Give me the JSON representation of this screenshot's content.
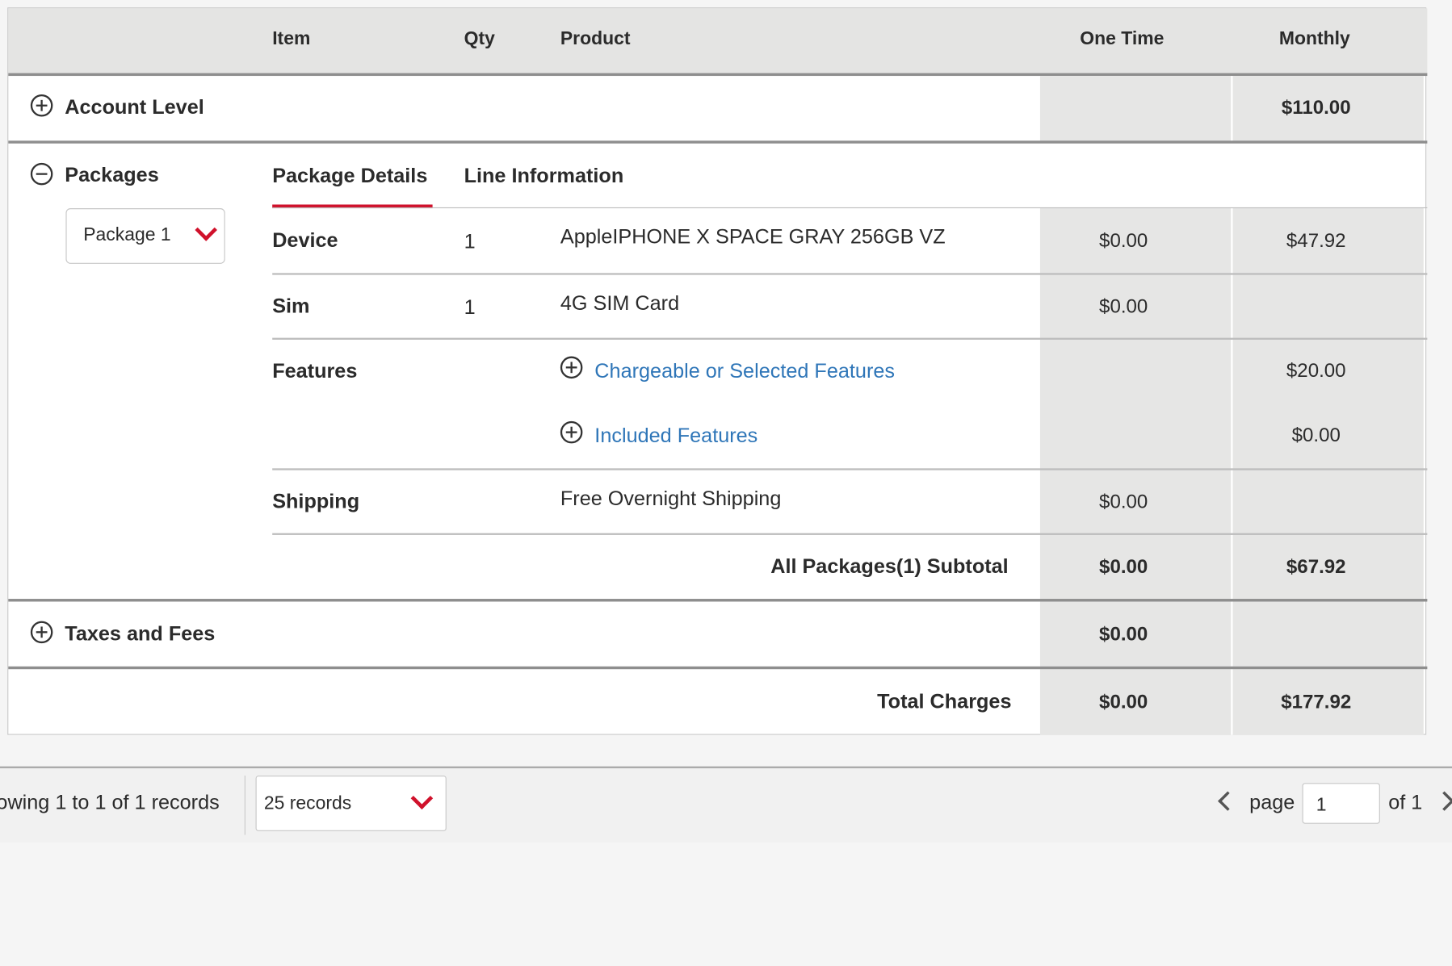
{
  "header": {
    "item": "Item",
    "qty": "Qty",
    "product": "Product",
    "one_time": "One Time",
    "monthly": "Monthly"
  },
  "account_level": {
    "label": "Account Level",
    "one_time": "",
    "monthly": "$110.00"
  },
  "packages": {
    "label": "Packages",
    "selected_package": "Package 1",
    "tabs": [
      "Package Details",
      "Line Information"
    ],
    "rows": {
      "device": {
        "label": "Device",
        "qty": "1",
        "product": "AppleIPHONE X SPACE GRAY 256GB VZ",
        "one_time": "$0.00",
        "monthly": "$47.92"
      },
      "sim": {
        "label": "Sim",
        "qty": "1",
        "product": "4G SIM Card",
        "one_time": "$0.00",
        "monthly": ""
      },
      "features": {
        "label": "Features",
        "chargeable_link": "Chargeable or Selected Features",
        "chargeable_monthly": "$20.00",
        "included_link": "Included Features",
        "included_monthly": "$0.00"
      },
      "shipping": {
        "label": "Shipping",
        "product": "Free Overnight Shipping",
        "one_time": "$0.00",
        "monthly": ""
      }
    },
    "subtotal": {
      "label": "All Packages(1) Subtotal",
      "one_time": "$0.00",
      "monthly": "$67.92"
    }
  },
  "taxes": {
    "label": "Taxes and Fees",
    "one_time": "$0.00",
    "monthly": ""
  },
  "total": {
    "label": "Total Charges",
    "one_time": "$0.00",
    "monthly": "$177.92"
  },
  "footer": {
    "records_text": "owing 1 to 1 of 1 records",
    "page_size": "25 records",
    "page_label": "page",
    "page_value": "1",
    "page_of": "of 1"
  },
  "colors": {
    "accent_red": "#d0112b",
    "link_blue": "#2f76b8",
    "header_grey": "#e4e4e3"
  },
  "icons": [
    "plus-circle-icon",
    "minus-circle-icon",
    "chevron-down-icon",
    "chevron-left-icon",
    "chevron-right-icon"
  ]
}
